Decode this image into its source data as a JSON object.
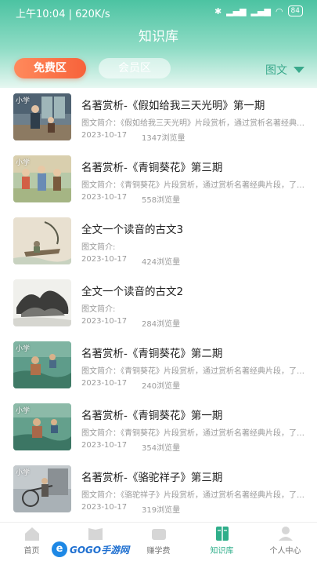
{
  "status": {
    "time_speed": "上午10:04 | 620K/s",
    "battery": "84"
  },
  "header": {
    "title": "知识库",
    "tab_free": "免费区",
    "tab_vip": "会员区",
    "filter": "图文"
  },
  "items": [
    {
      "tag": "小学",
      "title": "名著赏析-《假如给我三天光明》第一期",
      "desc": "图文简介：《假如给我三天光明》片段赏析，通过赏析名著经典片段，了解人物形象",
      "date": "2023-10-17",
      "views": "1347浏览量"
    },
    {
      "tag": "小学",
      "title": "名著赏析-《青铜葵花》第三期",
      "desc": "图文简介：《青铜葵花》片段赏析，通过赏析名著经典片段，了解人物形象",
      "date": "2023-10-17",
      "views": "558浏览量"
    },
    {
      "tag": "",
      "title": "全文一个读音的古文3",
      "desc": "图文简介:",
      "date": "2023-10-17",
      "views": "424浏览量"
    },
    {
      "tag": "",
      "title": "全文一个读音的古文2",
      "desc": "图文简介:",
      "date": "2023-10-17",
      "views": "284浏览量"
    },
    {
      "tag": "小学",
      "title": "名著赏析-《青铜葵花》第二期",
      "desc": "图文简介：《青铜葵花》片段赏析，通过赏析名著经典片段，了解人物形象",
      "date": "2023-10-17",
      "views": "240浏览量"
    },
    {
      "tag": "小学",
      "title": "名著赏析-《青铜葵花》第一期",
      "desc": "图文简介：《青铜葵花》片段赏析，通过赏析名著经典片段，了解人物形象",
      "date": "2023-10-17",
      "views": "354浏览量"
    },
    {
      "tag": "小学",
      "title": "名著赏析-《骆驼祥子》第三期",
      "desc": "图文简介：《骆驼祥子》片段赏析，通过赏析名著经典片段，了解人物形象",
      "date": "2023-10-17",
      "views": "319浏览量"
    }
  ],
  "tabbar": {
    "home": "首页",
    "earn": "赚学费",
    "knowledge": "知识库",
    "profile": "个人中心"
  },
  "watermark": {
    "text": "GOGO手游网"
  },
  "colors": {
    "accent": "#2fae8a",
    "free_tab": "#f7623a"
  }
}
